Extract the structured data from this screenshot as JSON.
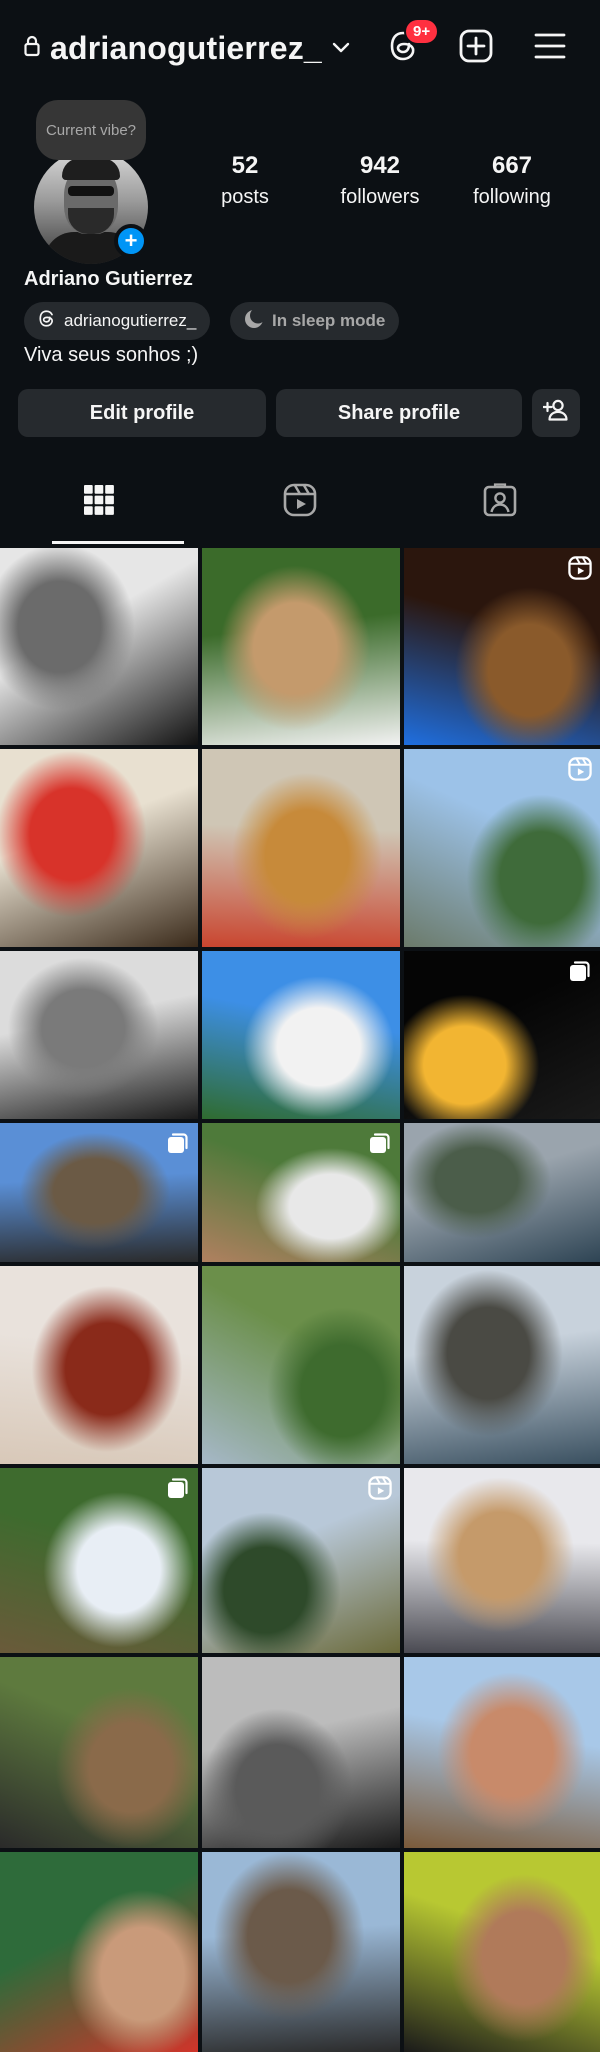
{
  "header": {
    "lock_icon": "lock-icon",
    "username": "adrianogutierrez_",
    "notification_badge": "9+",
    "icons": [
      "threads-icon",
      "new-post-icon",
      "menu-icon"
    ]
  },
  "profile": {
    "vibe_prompt": "Current vibe?",
    "add_story_symbol": "+",
    "stats": [
      {
        "value": "52",
        "label": "posts"
      },
      {
        "value": "942",
        "label": "followers"
      },
      {
        "value": "667",
        "label": "following"
      }
    ],
    "full_name": "Adriano Gutierrez",
    "threads_handle": "adrianogutierrez_",
    "status": "In sleep mode",
    "bio": "Viva seus sonhos ;)"
  },
  "actions": {
    "edit_profile": "Edit profile",
    "share_profile": "Share profile",
    "add_person_icon": "add-person-icon"
  },
  "tabs": [
    {
      "name": "posts-grid",
      "icon": "grid-icon",
      "active": true
    },
    {
      "name": "reels",
      "icon": "reels-icon",
      "active": false
    },
    {
      "name": "tagged",
      "icon": "tagged-person-icon",
      "active": false
    }
  ],
  "posts": [
    {
      "subject": "man-selfie-sunglasses-bw",
      "marker": "none",
      "colors": [
        "#e6e6e6",
        "#6b6b6b",
        "#111111"
      ]
    },
    {
      "subject": "man-hat-sunglasses",
      "marker": "none",
      "colors": [
        "#3b6b2a",
        "#c49a6c",
        "#f2f2f2"
      ]
    },
    {
      "subject": "chocolate-cake",
      "marker": "reel",
      "colors": [
        "#2b160d",
        "#8a5a2b",
        "#1f6fe0"
      ]
    },
    {
      "subject": "pizzas",
      "marker": "none",
      "colors": [
        "#e8e0d0",
        "#d8332a",
        "#3a2a1a"
      ]
    },
    {
      "subject": "fries-and-pizza",
      "marker": "none",
      "colors": [
        "#cfc6b5",
        "#c78a3a",
        "#c9452f"
      ]
    },
    {
      "subject": "lake-festival",
      "marker": "reel",
      "colors": [
        "#9cc2e8",
        "#3f6b3a",
        "#6b7a6a"
      ]
    },
    {
      "subject": "selfie-castle-bw",
      "marker": "none",
      "colors": [
        "#dcdcdc",
        "#7a7a7a",
        "#1a1a1a"
      ]
    },
    {
      "subject": "neuschwanstein-castle",
      "marker": "none",
      "colors": [
        "#3d8fe6",
        "#f2f2f2",
        "#2f6b2f"
      ]
    },
    {
      "subject": "eiffel-tower-night",
      "marker": "carousel",
      "colors": [
        "#050505",
        "#f2b532",
        "#1a1a1a"
      ]
    },
    {
      "subject": "louvre-building",
      "marker": "carousel",
      "colors": [
        "#5a8fd6",
        "#6b5a45",
        "#2a2a2a"
      ]
    },
    {
      "subject": "selfie-cows",
      "marker": "carousel",
      "colors": [
        "#4e7a3a",
        "#e8e8e8",
        "#b08060"
      ]
    },
    {
      "subject": "mountain-lake",
      "marker": "none",
      "colors": [
        "#9aa4ad",
        "#4b5d4a",
        "#2e4454"
      ]
    },
    {
      "subject": "kebab",
      "marker": "none",
      "colors": [
        "#e9e2dc",
        "#8a2a1a",
        "#d8c8b8"
      ]
    },
    {
      "subject": "bicycles",
      "marker": "none",
      "colors": [
        "#6b8f4a",
        "#3e6b2e",
        "#a6b8c8"
      ]
    },
    {
      "subject": "town-lakeside",
      "marker": "none",
      "colors": [
        "#c8d2dc",
        "#4a4a44",
        "#3a5060"
      ]
    },
    {
      "subject": "tilted-tree",
      "marker": "carousel",
      "colors": [
        "#3e6b2e",
        "#e8eef5",
        "#6a5a3a"
      ]
    },
    {
      "subject": "glider-airfield",
      "marker": "reel",
      "colors": [
        "#b8c8d8",
        "#2e4a2a",
        "#6b6a3a"
      ]
    },
    {
      "subject": "dog-filter-selfie",
      "marker": "none",
      "colors": [
        "#e8e8ec",
        "#c59a6a",
        "#4a4a52"
      ]
    },
    {
      "subject": "group-outdoors",
      "marker": "none",
      "colors": [
        "#5e7a3e",
        "#8a6a4a",
        "#2a2a2a"
      ]
    },
    {
      "subject": "selfie-bed-bw",
      "marker": "none",
      "colors": [
        "#bcbcbc",
        "#5a5a5a",
        "#1a1a1a"
      ]
    },
    {
      "subject": "selfie-with-child",
      "marker": "none",
      "colors": [
        "#a8c8e8",
        "#c88a6a",
        "#7a5a3a"
      ]
    },
    {
      "subject": "tongue-selfie",
      "marker": "none",
      "colors": [
        "#2e6b3a",
        "#c99a7a",
        "#d0342a"
      ]
    },
    {
      "subject": "beach-and-car",
      "marker": "none",
      "colors": [
        "#9ab8d6",
        "#6b5a4a",
        "#2a2a2a"
      ]
    },
    {
      "subject": "lying-selfie",
      "marker": "none",
      "colors": [
        "#b8c832",
        "#b07a5a",
        "#1a1a1a"
      ]
    }
  ]
}
